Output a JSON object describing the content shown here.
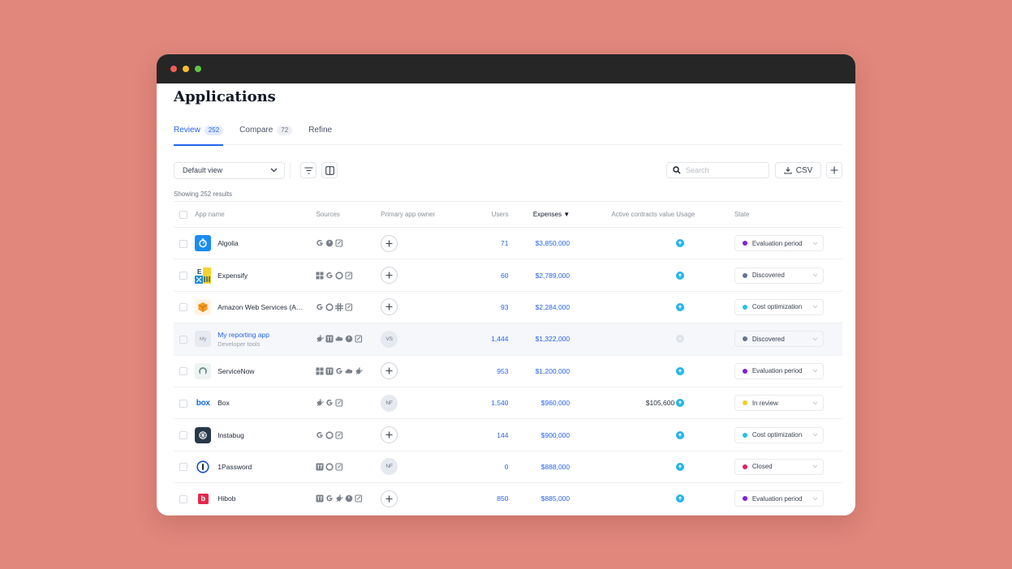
{
  "page": {
    "title": "Applications"
  },
  "tabs": [
    {
      "label": "Review",
      "count": "252",
      "active": true
    },
    {
      "label": "Compare",
      "count": "72",
      "active": false
    },
    {
      "label": "Refine",
      "count": "",
      "active": false
    }
  ],
  "toolbar": {
    "view_label": "Default view",
    "search_placeholder": "Search",
    "csv_label": "CSV"
  },
  "results_text": "Showing 252 results",
  "columns": {
    "app_name": "App name",
    "sources": "Sources",
    "owner": "Primary app owner",
    "users": "Users",
    "expenses": "Expenses",
    "contracts": "Active contracts value",
    "usage": "Usage",
    "state": "State"
  },
  "state_colors": {
    "Evaluation period": "#7c1fe6",
    "Discovered": "#64748b",
    "Cost optimization": "#22c3e6",
    "In review": "#f0d21c",
    "Closed": "#e11d63"
  },
  "rows": [
    {
      "name": "Algolia",
      "sub": "",
      "logo": "algolia-logo",
      "sources": [
        "google-icon",
        "toggl-icon",
        "form-icon"
      ],
      "owner": "",
      "users": "71",
      "expenses": "$3,850,000",
      "contracts": "",
      "usage": "active",
      "state": "Evaluation period"
    },
    {
      "name": "Expensify",
      "sub": "",
      "logo": "expensify-logo",
      "sources": [
        "windows-icon",
        "google-icon",
        "circle-g-icon",
        "form-icon"
      ],
      "owner": "",
      "users": "60",
      "expenses": "$2,789,000",
      "contracts": "",
      "usage": "active",
      "state": "Discovered"
    },
    {
      "name": "Amazon Web Services (A…",
      "sub": "",
      "logo": "aws-logo",
      "sources": [
        "google-icon",
        "circle-g-icon",
        "slack-icon",
        "form-icon"
      ],
      "owner": "",
      "users": "93",
      "expenses": "$2,284,000",
      "contracts": "",
      "usage": "active",
      "state": "Cost optimization"
    },
    {
      "name": "My reporting app",
      "sub": "Developer tools",
      "logo": "my-logo",
      "logo_text": "My",
      "sources": [
        "plug-icon",
        "tt-icon",
        "cloud-icon",
        "toggl-icon",
        "form-icon"
      ],
      "owner": "VS",
      "users": "1,444",
      "expenses": "$1,322,000",
      "contracts": "",
      "usage": "none",
      "state": "Discovered"
    },
    {
      "name": "ServiceNow",
      "sub": "",
      "logo": "servicenow-logo",
      "sources": [
        "windows-icon",
        "tt-icon",
        "google-icon",
        "cloud-icon",
        "plug-icon"
      ],
      "owner": "",
      "users": "953",
      "expenses": "$1,200,000",
      "contracts": "",
      "usage": "active",
      "state": "Evaluation period"
    },
    {
      "name": "Box",
      "sub": "",
      "logo": "box-logo",
      "logo_text": "box",
      "sources": [
        "plug-icon",
        "google-icon",
        "form-icon"
      ],
      "owner": "NF",
      "users": "1,540",
      "expenses": "$960,000",
      "contracts": "$105,600",
      "usage": "active",
      "state": "In review"
    },
    {
      "name": "Instabug",
      "sub": "",
      "logo": "instabug-logo",
      "sources": [
        "google-icon",
        "circle-g-icon",
        "form-icon"
      ],
      "owner": "",
      "users": "144",
      "expenses": "$900,000",
      "contracts": "",
      "usage": "active",
      "state": "Cost optimization"
    },
    {
      "name": "1Password",
      "sub": "",
      "logo": "onepassword-logo",
      "sources": [
        "tt-icon",
        "circle-g-icon",
        "form-icon"
      ],
      "owner": "NF",
      "users": "0",
      "expenses": "$888,000",
      "contracts": "",
      "usage": "active",
      "state": "Closed"
    },
    {
      "name": "Hibob",
      "sub": "",
      "logo": "hibob-logo",
      "logo_text": "b",
      "sources": [
        "tt-icon",
        "google-icon",
        "plug-icon",
        "toggl-icon",
        "form-icon"
      ],
      "owner": "",
      "users": "850",
      "expenses": "$885,000",
      "contracts": "",
      "usage": "active",
      "state": "Evaluation period"
    }
  ]
}
